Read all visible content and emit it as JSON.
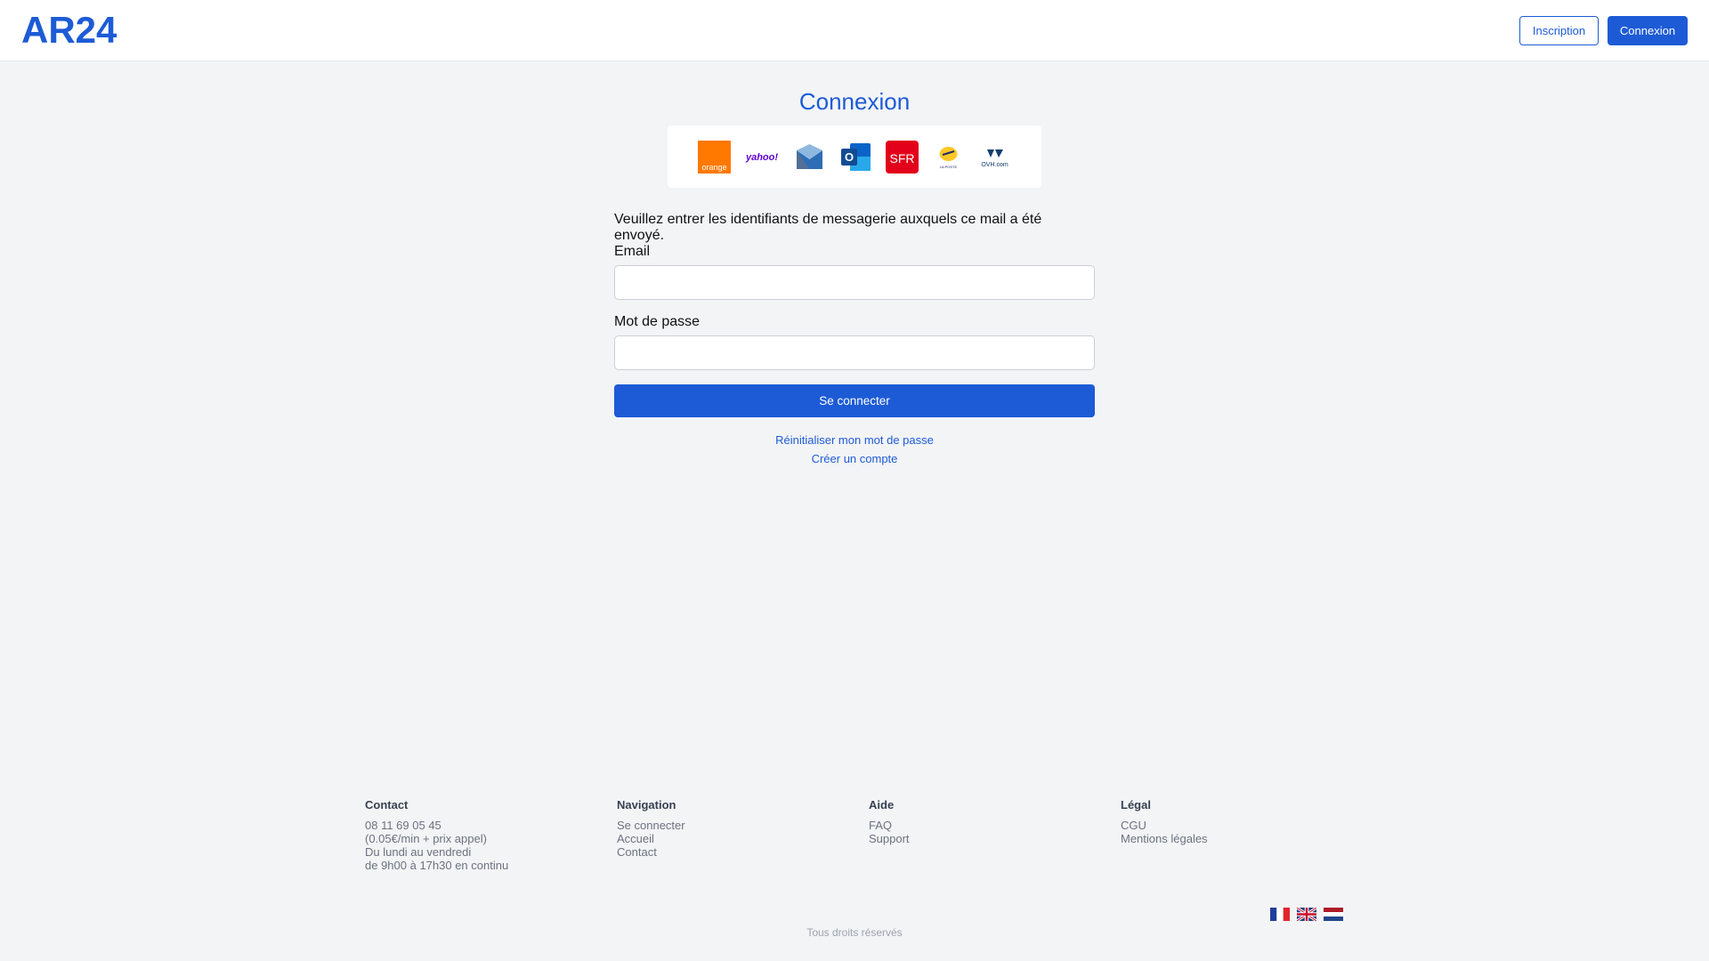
{
  "header": {
    "logo": "AR24",
    "signup_label": "Inscription",
    "login_label": "Connexion"
  },
  "main": {
    "title": "Connexion",
    "providers": [
      {
        "name": "orange-logo-icon",
        "label": "orange"
      },
      {
        "name": "yahoo-logo-icon",
        "label": "yahoo!"
      },
      {
        "name": "proton-logo-icon"
      },
      {
        "name": "outlook-logo-icon",
        "label": "O"
      },
      {
        "name": "sfr-logo-icon",
        "label": "SFR"
      },
      {
        "name": "laposte-logo-icon",
        "label": "LA POSTE"
      },
      {
        "name": "ovh-logo-icon",
        "label": "OVH.com"
      }
    ],
    "intro": "Veuillez entrer les identifiants de messagerie auxquels ce mail a été envoyé.",
    "email_label": "Email",
    "email_value": "",
    "password_label": "Mot de passe",
    "password_value": "",
    "submit_label": "Se connecter",
    "reset_link": "Réinitialiser mon mot de passe",
    "create_link": "Créer un compte"
  },
  "footer": {
    "contact": {
      "title": "Contact",
      "lines": [
        "08 11 69 05 45",
        "(0.05€/min + prix appel)",
        "Du lundi au vendredi",
        "de 9h00 à 17h30 en continu"
      ]
    },
    "navigation": {
      "title": "Navigation",
      "items": [
        "Se connecter",
        "Accueil",
        "Contact"
      ]
    },
    "aide": {
      "title": "Aide",
      "items": [
        "FAQ",
        "Support"
      ]
    },
    "legal": {
      "title": "Légal",
      "items": [
        "CGU",
        "Mentions légales"
      ]
    },
    "flags": [
      "fr-flag-icon",
      "uk-flag-icon",
      "nl-flag-icon"
    ],
    "copyright": "Tous droits réservés"
  },
  "colors": {
    "accent": "#1d5bd6",
    "background": "#f3f4f6"
  }
}
